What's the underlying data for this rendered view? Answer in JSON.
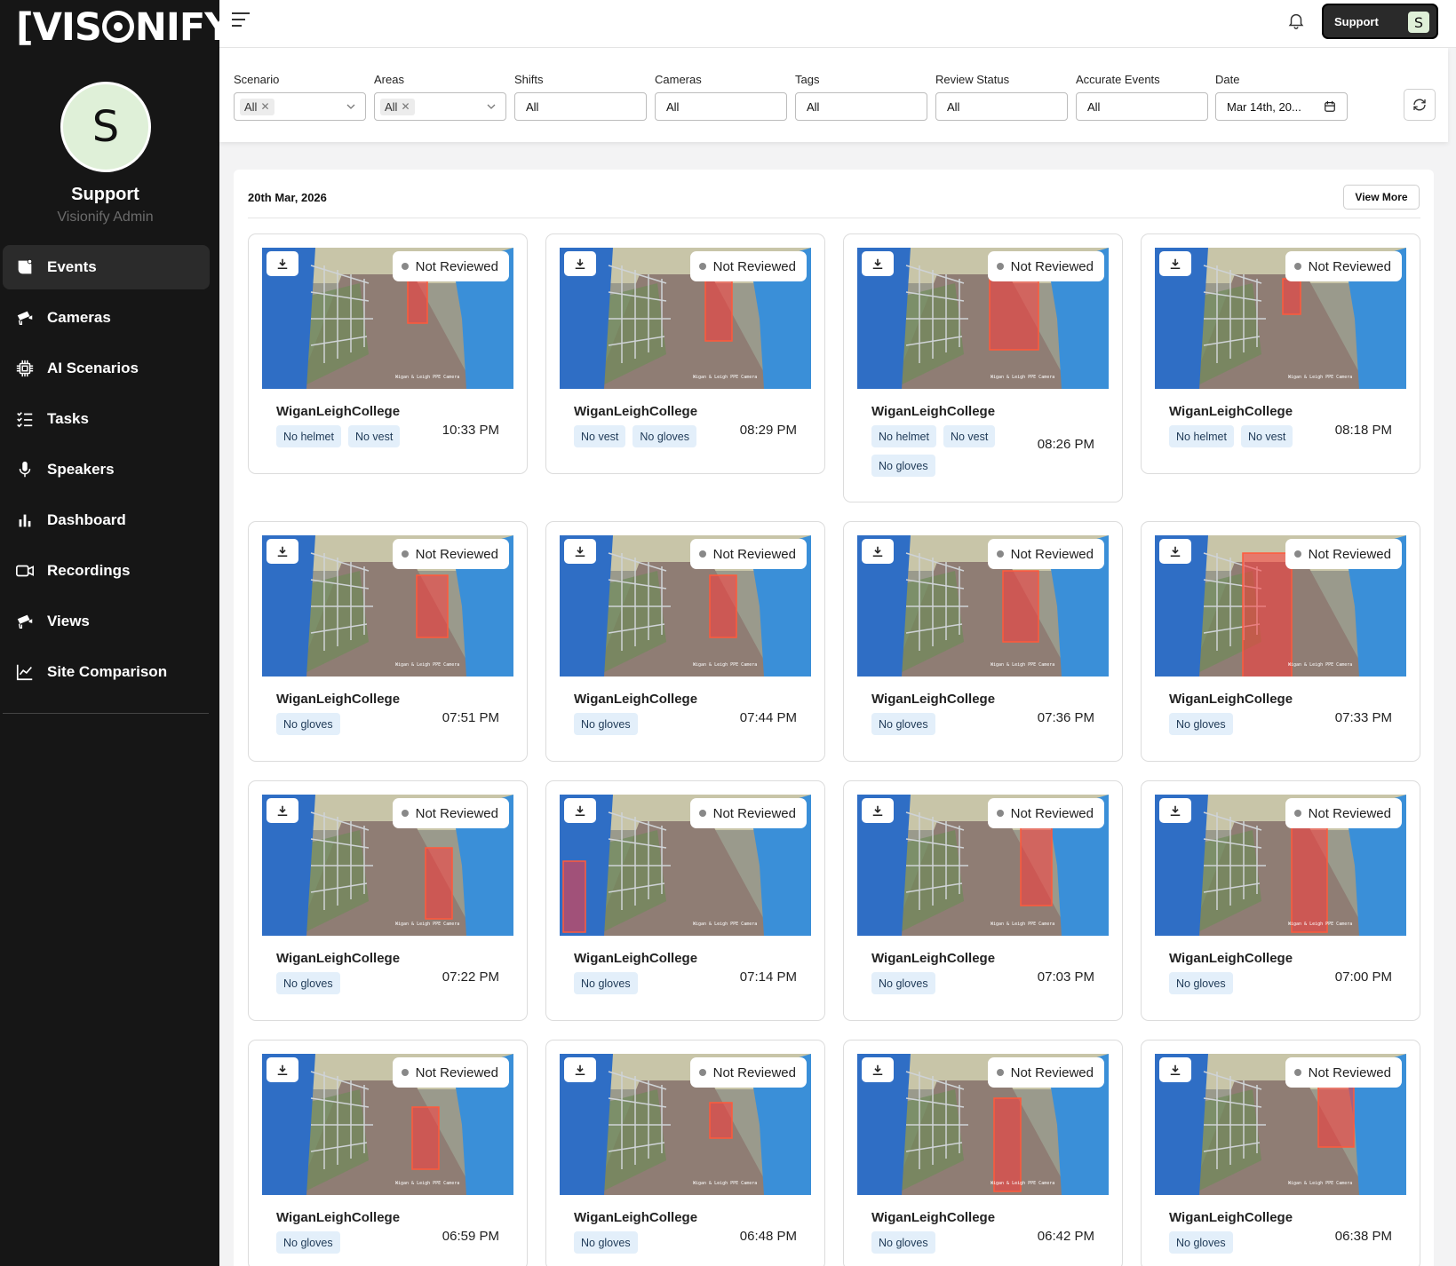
{
  "brand": {
    "logo_left": "[VIS",
    "logo_right": "NIFY]",
    "trademark": "®"
  },
  "user": {
    "initial": "S",
    "name": "Support",
    "role": "Visionify Admin"
  },
  "nav": [
    {
      "label": "Events",
      "icon": "events-icon",
      "active": true
    },
    {
      "label": "Cameras",
      "icon": "camera-icon"
    },
    {
      "label": "AI Scenarios",
      "icon": "chip-icon"
    },
    {
      "label": "Tasks",
      "icon": "tasks-icon"
    },
    {
      "label": "Speakers",
      "icon": "microphone-icon"
    },
    {
      "label": "Dashboard",
      "icon": "bar-chart-icon"
    },
    {
      "label": "Recordings",
      "icon": "video-icon"
    },
    {
      "label": "Views",
      "icon": "camera-icon"
    },
    {
      "label": "Site Comparison",
      "icon": "line-chart-icon"
    }
  ],
  "topbar": {
    "support_label": "Support",
    "support_initial": "S"
  },
  "filters": [
    {
      "label": "Scenario",
      "value": "All",
      "type": "chip"
    },
    {
      "label": "Areas",
      "value": "All",
      "type": "chip"
    },
    {
      "label": "Shifts",
      "value": "All",
      "type": "plain"
    },
    {
      "label": "Cameras",
      "value": "All",
      "type": "plain"
    },
    {
      "label": "Tags",
      "value": "All",
      "type": "plain"
    },
    {
      "label": "Review Status",
      "value": "All",
      "type": "plain"
    },
    {
      "label": "Accurate Events",
      "value": "All",
      "type": "plain"
    },
    {
      "label": "Date",
      "value": "Mar 14th, 20...",
      "type": "date"
    }
  ],
  "events_section": {
    "date": "20th Mar, 2026",
    "view_more": "View More",
    "status_label": "Not Reviewed",
    "events": [
      {
        "site": "WiganLeighCollege",
        "tags": [
          "No helmet",
          "No vest"
        ],
        "time": "10:33 PM"
      },
      {
        "site": "WiganLeighCollege",
        "tags": [
          "No vest",
          "No gloves"
        ],
        "time": "08:29 PM"
      },
      {
        "site": "WiganLeighCollege",
        "tags": [
          "No helmet",
          "No vest",
          "No gloves"
        ],
        "time": "08:26 PM"
      },
      {
        "site": "WiganLeighCollege",
        "tags": [
          "No helmet",
          "No vest"
        ],
        "time": "08:18 PM"
      },
      {
        "site": "WiganLeighCollege",
        "tags": [
          "No gloves"
        ],
        "time": "07:51 PM"
      },
      {
        "site": "WiganLeighCollege",
        "tags": [
          "No gloves"
        ],
        "time": "07:44 PM"
      },
      {
        "site": "WiganLeighCollege",
        "tags": [
          "No gloves"
        ],
        "time": "07:36 PM"
      },
      {
        "site": "WiganLeighCollege",
        "tags": [
          "No gloves"
        ],
        "time": "07:33 PM"
      },
      {
        "site": "WiganLeighCollege",
        "tags": [
          "No gloves"
        ],
        "time": "07:22 PM"
      },
      {
        "site": "WiganLeighCollege",
        "tags": [
          "No gloves"
        ],
        "time": "07:14 PM"
      },
      {
        "site": "WiganLeighCollege",
        "tags": [
          "No gloves"
        ],
        "time": "07:03 PM"
      },
      {
        "site": "WiganLeighCollege",
        "tags": [
          "No gloves"
        ],
        "time": "07:00 PM"
      },
      {
        "site": "WiganLeighCollege",
        "tags": [
          "No gloves"
        ],
        "time": "06:59 PM"
      },
      {
        "site": "WiganLeighCollege",
        "tags": [
          "No gloves"
        ],
        "time": "06:48 PM"
      },
      {
        "site": "WiganLeighCollege",
        "tags": [
          "No gloves"
        ],
        "time": "06:42 PM"
      },
      {
        "site": "WiganLeighCollege",
        "tags": [
          "No gloves"
        ],
        "time": "06:38 PM"
      }
    ]
  },
  "colors": {
    "sidebar_bg": "#161616",
    "tag_bg": "#e3effa",
    "detection_box": "#ff3b3b",
    "accent_avatar": "#dff0d8"
  }
}
